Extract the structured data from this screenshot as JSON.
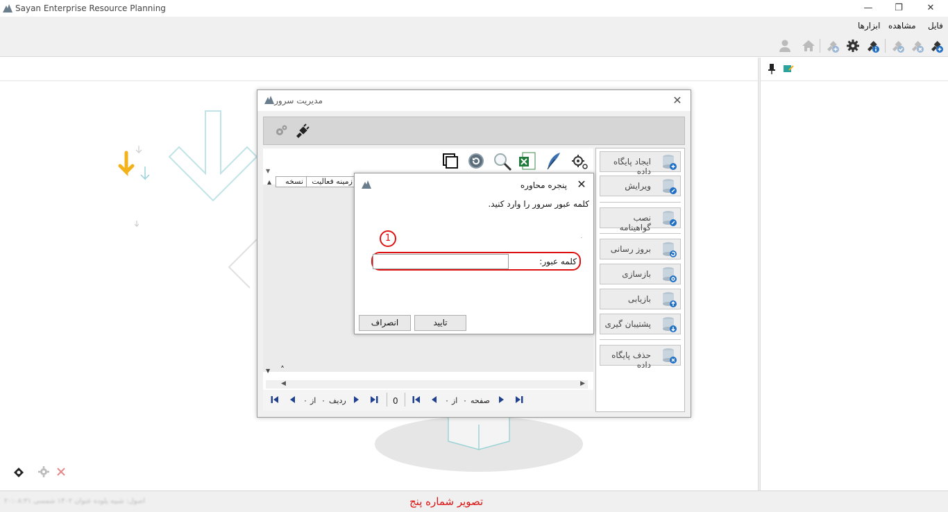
{
  "window": {
    "title": "Sayan Enterprise Resource Planning"
  },
  "menu": {
    "items": [
      "فایل",
      "مشاهده",
      "ابزارها"
    ]
  },
  "status": {
    "left_text": "اصول: شبیه پلوده عنوان ۱۴۰۲ شمسی ۲۰:۰۸:۳۱",
    "caption": "تصویر شماره پنج"
  },
  "server_manager": {
    "title": "مدیریت سرور",
    "grid_headers": [
      "نسخه",
      "زمینه فعالیت"
    ],
    "side_buttons": [
      "ایجاد پایگاه داده",
      "ویرایش",
      "نصب گواهینامه",
      "بروز رسانی",
      "بازسازی",
      "بازیابی",
      "پشتیبان گیری",
      "حذف پایگاه داده"
    ],
    "nav_right": {
      "page": "صفحه",
      "value": "۰",
      "of": "از",
      "total": "۰"
    },
    "nav_count": "0",
    "nav_left": {
      "row": "ردیف",
      "value": "۰",
      "of": "از",
      "total": "۰"
    }
  },
  "dialog": {
    "title": "پنجره محاوره",
    "message": "کلمه عبور سرور را وارد کنید.",
    "dot": ".",
    "password_label": "کلمه عبور:",
    "password_value": "",
    "step_number": "1",
    "ok_label": "تایید",
    "cancel_label": "انصراف"
  }
}
